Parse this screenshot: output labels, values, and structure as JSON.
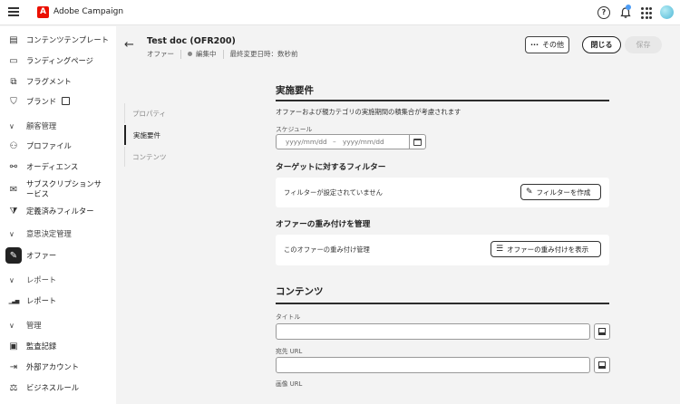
{
  "app": {
    "name": "Adobe Campaign",
    "logo_letter": "A"
  },
  "topbar": {
    "help": "?"
  },
  "sidebar": {
    "items": [
      {
        "label": "コンテンツテンプレート",
        "icon": "template-icon",
        "glyph": "▤"
      },
      {
        "label": "ランディングページ",
        "icon": "landing-page-icon",
        "glyph": "▭"
      },
      {
        "label": "フラグメント",
        "icon": "fragment-icon",
        "glyph": "⧉"
      },
      {
        "label": "ブランド",
        "icon": "brand-icon",
        "glyph": "⛉"
      }
    ],
    "section_customer": "顧客管理",
    "customer_items": [
      {
        "label": "プロファイル",
        "icon": "profile-icon",
        "glyph": "⚇"
      },
      {
        "label": "オーディエンス",
        "icon": "audience-icon",
        "glyph": "⚯"
      },
      {
        "label": "サブスクリプションサ",
        "label2": "ービス",
        "icon": "subscription-icon",
        "glyph": "✉"
      },
      {
        "label": "定義済みフィルター",
        "icon": "filter-icon",
        "glyph": "⧩"
      }
    ],
    "section_decision": "意思決定管理",
    "decision_items": [
      {
        "label": "オファー",
        "icon": "offer-icon",
        "glyph": "✎"
      }
    ],
    "section_report": "レポート",
    "report_items": [
      {
        "label": "レポート",
        "icon": "report-icon",
        "glyph": "▁▃▅"
      }
    ],
    "section_admin": "管理",
    "admin_items": [
      {
        "label": "監査記録",
        "icon": "audit-icon",
        "glyph": "▣"
      },
      {
        "label": "外部アカウント",
        "icon": "external-account-icon",
        "glyph": "⇥"
      },
      {
        "label": "ビジネスルール",
        "icon": "business-rule-icon",
        "glyph": "⚖"
      }
    ]
  },
  "header": {
    "title": "Test doc (OFR200)",
    "type": "オファー",
    "status": "編集中",
    "last_modified": "最終変更日時：数秒前",
    "buttons": {
      "other": "その他",
      "close": "閉じる",
      "save": "保存"
    }
  },
  "leftnav": {
    "items": [
      "プロパティ",
      "実施要件",
      "コンテンツ"
    ]
  },
  "eligibility": {
    "title": "実施要件",
    "description": "オファーおよび親カテゴリの実施期間の積集合が考慮されます",
    "schedule_label": "スケジュール",
    "start_placeholder": "yyyy/mm/dd",
    "dash": "–",
    "end_placeholder": "yyyy/mm/dd",
    "filter_title": "ターゲットに対するフィルター",
    "filter_text": "フィルターが設定されていません",
    "filter_button": "フィルターを作成",
    "weight_title": "オファーの重み付けを管理",
    "weight_text": "このオファーの重み付け管理",
    "weight_button": "オファーの重み付けを表示"
  },
  "content": {
    "title": "コンテンツ",
    "title_label": "タイトル",
    "dest_url_label": "宛先 URL",
    "image_url_label": "画像 URL"
  }
}
